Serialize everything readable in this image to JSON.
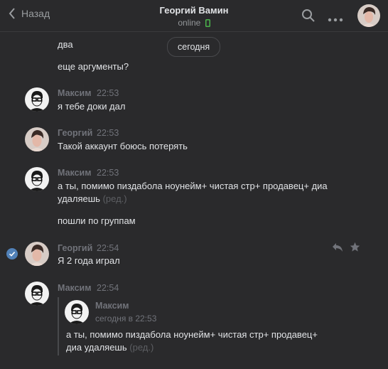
{
  "header": {
    "back_label": "Назад",
    "peer_name": "Георгий Вамин",
    "peer_status": "online"
  },
  "date_divider": "сегодня",
  "messages": [
    {
      "text": "два"
    },
    {
      "text": "еще аргументы?"
    },
    {
      "author": "Максим",
      "time": "22:53",
      "text": "я тебе доки дал"
    },
    {
      "author": "Георгий",
      "time": "22:53",
      "text": "Такой аккаунт боюсь потерять"
    },
    {
      "author": "Максим",
      "time": "22:53",
      "text_line1": "а ты, помимо пиздабола ноунейм+ чистая стр+ продавец+ диа",
      "text_line2": "удаляешь",
      "edited": "(ред.)"
    },
    {
      "text": "пошли по группам"
    },
    {
      "author": "Георгий",
      "time": "22:54",
      "text": "Я 2 года играл"
    },
    {
      "author": "Максим",
      "time": "22:54"
    }
  ],
  "quoted": {
    "author": "Максим",
    "time": "сегодня в 22:53",
    "text_line1": "а ты, помимо пиздабола ноунейм+ чистая стр+ продавец+",
    "text_line2": "диа удаляешь",
    "edited": "(ред.)"
  },
  "icons": {
    "back": "chevron-left-icon",
    "search": "search-icon",
    "more": "more-icon",
    "reply": "reply-icon",
    "star": "star-icon",
    "selected": "check-circle-icon"
  },
  "colors": {
    "background": "#2a2a2c",
    "text": "#e1e3e6",
    "secondary": "#71737a",
    "online_phone": "#4bb34b",
    "selected_check": "#5181b8"
  }
}
